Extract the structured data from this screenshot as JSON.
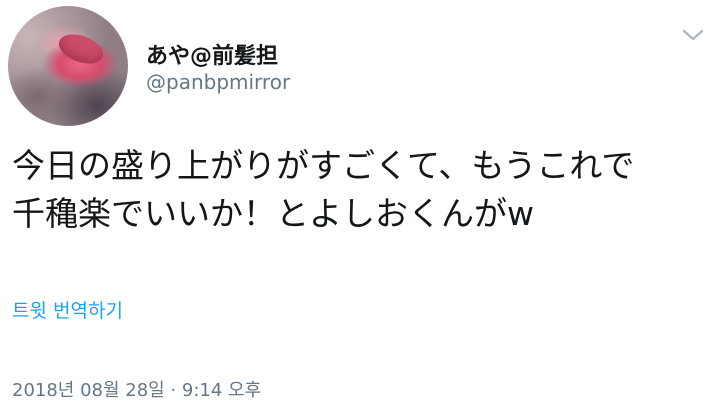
{
  "tweet": {
    "display_name": "あや@前髪担",
    "handle": "@panbpmirror",
    "text": "今日の盛り上がりがすごくて、もうこれで\n千穐楽でいいか！とよしおくんがw",
    "translate_label": "트윗 번역하기",
    "timestamp": "2018년 08월 28일 · 9:14 오후"
  },
  "icons": {
    "menu_caret": "chevron-down-icon",
    "avatar": "avatar"
  },
  "colors": {
    "text": "#14171a",
    "secondary": "#657786",
    "link": "#1da1f2",
    "caret": "#aab8c2"
  }
}
